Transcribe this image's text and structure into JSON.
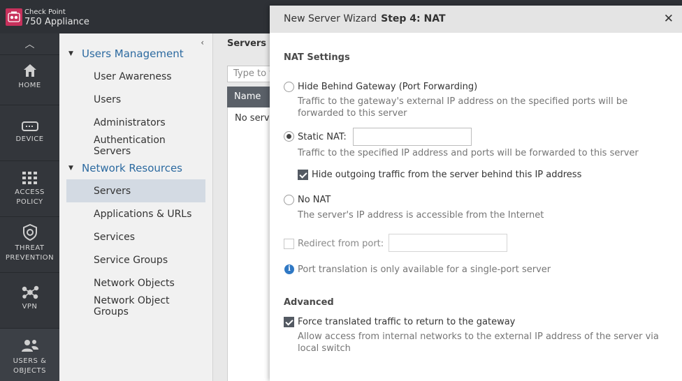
{
  "brand": {
    "small": "Check Point",
    "main": "750 Appliance"
  },
  "rail": {
    "items": [
      {
        "icon": "home-icon",
        "label": "HOME"
      },
      {
        "icon": "device-icon",
        "label": "DEVICE"
      },
      {
        "icon": "access-policy-icon",
        "label": "ACCESS\nPOLICY"
      },
      {
        "icon": "threat-prevention-icon",
        "label": "THREAT\nPREVENTION"
      },
      {
        "icon": "vpn-icon",
        "label": "VPN"
      },
      {
        "icon": "users-objects-icon",
        "label": "USERS &\nOBJECTS"
      }
    ]
  },
  "subnav": {
    "groups": [
      {
        "title": "Users Management",
        "items": [
          "User Awareness",
          "Users",
          "Administrators",
          "Authentication Servers"
        ]
      },
      {
        "title": "Network Resources",
        "items": [
          "Servers",
          "Applications & URLs",
          "Services",
          "Service Groups",
          "Network Objects",
          "Network Object Groups"
        ]
      }
    ],
    "selected": "Servers"
  },
  "main": {
    "title": "Servers De",
    "search_placeholder": "Type to fi",
    "column_name": "Name",
    "empty_text": "No serve"
  },
  "wizard": {
    "title": "New Server Wizard",
    "step": "Step 4: NAT",
    "nat_section": "NAT Settings",
    "hide_behind_label": "Hide Behind Gateway (Port Forwarding)",
    "hide_behind_desc": "Traffic to the gateway's external IP address on the specified ports will be forwarded to this server",
    "static_nat_label": "Static NAT:",
    "static_nat_value": "",
    "static_nat_desc": "Traffic to the specified IP address and ports will be forwarded to this server",
    "hide_outgoing_label": "Hide outgoing traffic from the server behind this IP address",
    "no_nat_label": "No NAT",
    "no_nat_desc": "The server's IP address is accessible from the Internet",
    "redirect_label": "Redirect from port:",
    "redirect_value": "",
    "port_info": "Port translation is only available for a single-port server",
    "advanced_section": "Advanced",
    "force_label": "Force translated traffic to return to the gateway",
    "force_desc": "Allow access from internal networks to the external IP address of the server via local switch",
    "selected_nat": "Static NAT",
    "hide_outgoing_checked": true,
    "redirect_checked": false,
    "force_checked": true
  }
}
